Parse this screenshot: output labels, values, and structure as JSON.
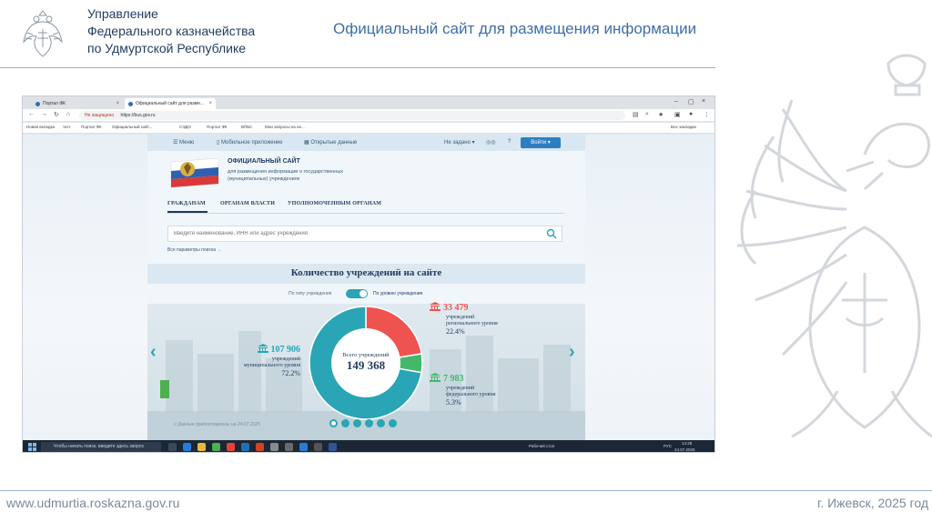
{
  "header": {
    "org_line1": "Управление",
    "org_line2": "Федерального казначейства",
    "org_line3": "по Удмуртской Республике",
    "title": "Официальный сайт для размещения информации"
  },
  "browser": {
    "tab1": "Портал ФК",
    "tab2": "Официальный сайт для разме...",
    "url_warning": "Не защищено",
    "url": "https://bus.gov.ru",
    "bookmarks": [
      "Новая вкладка",
      "тест",
      "Портал ФК",
      "Официальный сайт...",
      "СЭДО",
      "Портал ФК",
      "ВПБС",
      "Мои запросы на не..."
    ],
    "bookmarks_right": "Все закладки"
  },
  "site": {
    "nav": {
      "menu": "Меню",
      "mobile": "Мобильное приложение",
      "open_data": "Открытые данные",
      "not_set": "Не задано",
      "login": "Войти"
    },
    "brand_title": "ОФИЦИАЛЬНЫЙ САЙТ",
    "brand_sub": "для размещения информации о государственных (муниципальных) учреждениях",
    "tabs": [
      "ГРАЖДАНАМ",
      "ОРГАНАМ ВЛАСТИ",
      "УПОЛНОМОЧЕННЫМ ОРГАНАМ"
    ],
    "search_placeholder": "Введите наименование, ИНН или адрес учреждения",
    "advanced_link": "Все параметры поиска →",
    "count_title": "Количество учреждений на сайте",
    "toggle_left": "По типу учреждения",
    "toggle_right": "По уровню учреждения",
    "total_label": "Всего учреждений",
    "total_value": "149 368",
    "updated": "Данные предоставлены на 24.07.2025",
    "active_dot": 0
  },
  "chart_data": {
    "type": "pie",
    "categories": [
      "учреждений муниципального уровня",
      "учреждений регионального уровня",
      "учреждений федерального уровня"
    ],
    "values": [
      107906,
      33479,
      7983
    ],
    "value_labels": [
      "107 906",
      "33 479",
      "7 983"
    ],
    "percent_labels": [
      "72.2%",
      "22.4%",
      "5.3%"
    ],
    "colors": [
      "#2aa5b5",
      "#ef5350",
      "#43b86a"
    ],
    "title": "Количество учреждений на сайте"
  },
  "taskbar": {
    "search": "Чтобы начать поиск, введите здесь запрос",
    "desk": "Рабочий стол",
    "lang": "РУС",
    "time": "14:28",
    "date": "24.07.2025"
  },
  "footer": {
    "website": "www.udmurtia.roskazna.gov.ru",
    "city_year": "г. Ижевск, 2025 год"
  }
}
